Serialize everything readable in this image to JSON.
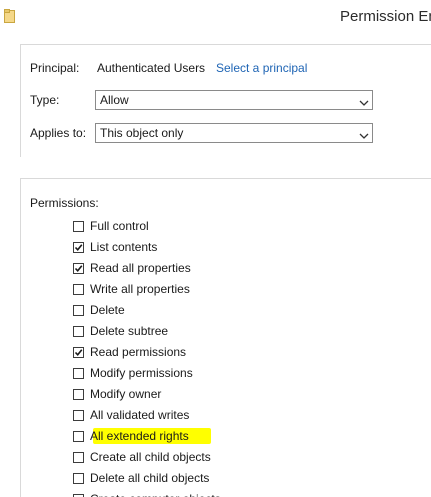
{
  "window": {
    "title": "Permission Ent",
    "icon": "folder-icon"
  },
  "principal": {
    "label": "Principal:",
    "value": "Authenticated Users",
    "link": "Select a principal"
  },
  "type": {
    "label": "Type:",
    "value": "Allow"
  },
  "applies_to": {
    "label": "Applies to:",
    "value": "This object only"
  },
  "permissions": {
    "title": "Permissions:",
    "items": [
      {
        "label": "Full control",
        "checked": false
      },
      {
        "label": "List contents",
        "checked": true
      },
      {
        "label": "Read all properties",
        "checked": true
      },
      {
        "label": "Write all properties",
        "checked": false
      },
      {
        "label": "Delete",
        "checked": false
      },
      {
        "label": "Delete subtree",
        "checked": false
      },
      {
        "label": "Read permissions",
        "checked": true
      },
      {
        "label": "Modify permissions",
        "checked": false
      },
      {
        "label": "Modify owner",
        "checked": false
      },
      {
        "label": "All validated writes",
        "checked": false
      },
      {
        "label": "All extended rights",
        "checked": false
      },
      {
        "label": "Create all child objects",
        "checked": false
      },
      {
        "label": "Delete all child objects",
        "checked": false
      },
      {
        "label": "Create computer objects",
        "checked": false
      }
    ]
  },
  "colors": {
    "link": "#1e64b4",
    "highlight": "#ffff00",
    "border": "#8a8a8a"
  }
}
